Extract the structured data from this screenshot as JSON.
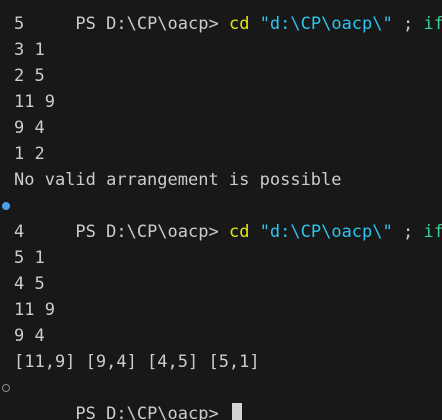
{
  "colors": {
    "background": "#181818",
    "text": "#cccccc",
    "command": "#e5e510",
    "string": "#2ec4f0",
    "keyword": "#3fcf8e",
    "decoration_filled": "#4aa0f0"
  },
  "terminal": {
    "top_prompt": {
      "prompt": "PS D:\\CP\\oacp> ",
      "cmd": "cd",
      "arg": "\"d:\\CP\\oacp\\\"",
      "sep": " ; ",
      "kw": "if",
      "tail": " ($"
    },
    "run1_output": [
      "5",
      "3 1",
      "2 5",
      "11 9",
      "9 4",
      "1 2",
      "No valid arrangement is possible"
    ],
    "second_prompt": {
      "prompt": "PS D:\\CP\\oacp> ",
      "cmd": "cd",
      "arg": "\"d:\\CP\\oacp\\\"",
      "sep": " ; ",
      "kw": "if",
      "tail": " ($"
    },
    "run2_output": [
      "4",
      "5 1",
      "4 5",
      "11 9",
      "9 4",
      "[11,9] [9,4] [4,5] [5,1]"
    ],
    "final_prompt": "PS D:\\CP\\oacp> "
  }
}
